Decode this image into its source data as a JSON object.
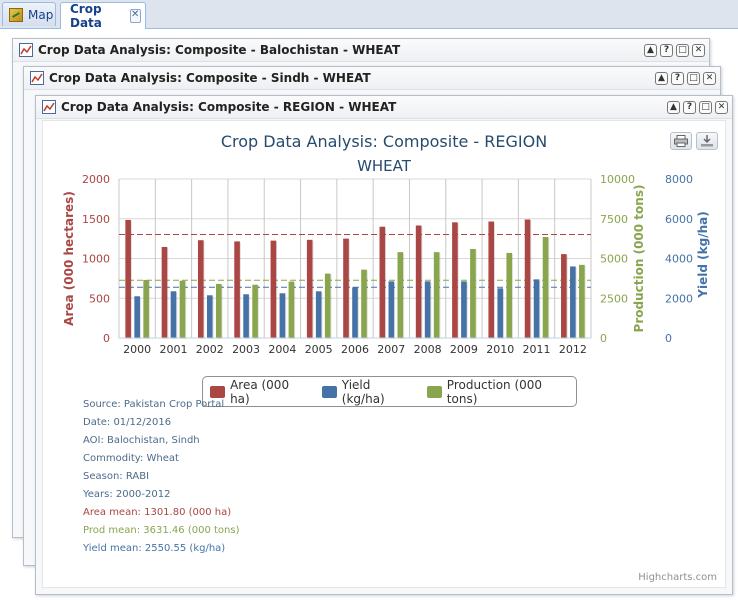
{
  "tabs": [
    {
      "label": "Map",
      "icon": "map-icon"
    },
    {
      "label": "Crop Data",
      "icon": "close-icon"
    }
  ],
  "windows": [
    {
      "title": "Crop Data Analysis: Composite - Balochistan - WHEAT"
    },
    {
      "title": "Crop Data Analysis: Composite - Sindh - WHEAT"
    },
    {
      "title": "Crop Data Analysis: Composite - REGION - WHEAT"
    }
  ],
  "window_tools": {
    "collapse": "▲",
    "help": "?",
    "maximize": "□",
    "close": "✕"
  },
  "chart_data": {
    "type": "bar",
    "title": "Crop Data Analysis: Composite - REGION",
    "subtitle": "WHEAT",
    "categories": [
      "2000",
      "2001",
      "2002",
      "2003",
      "2004",
      "2005",
      "2006",
      "2007",
      "2008",
      "2009",
      "2010",
      "2011",
      "2012"
    ],
    "series": [
      {
        "name": "Area (000 ha)",
        "color": "#aa4643",
        "axis": "left",
        "values": [
          1485,
          1145,
          1230,
          1215,
          1225,
          1235,
          1250,
          1400,
          1415,
          1455,
          1465,
          1490,
          1055
        ]
      },
      {
        "name": "Yield (kg/ha)",
        "color": "#4572a7",
        "axis": "right2",
        "values": [
          2100,
          2350,
          2150,
          2200,
          2250,
          2350,
          2550,
          2850,
          2850,
          2850,
          2500,
          2950,
          3600
        ]
      },
      {
        "name": "Production (000 tons)",
        "color": "#89a54e",
        "axis": "right1",
        "values": [
          3650,
          3600,
          3400,
          3350,
          3550,
          4050,
          4300,
          5400,
          5400,
          5600,
          5350,
          6350,
          4600
        ]
      }
    ],
    "axes": {
      "left": {
        "label": "Area (000 hectares)",
        "min": 0,
        "max": 2000,
        "ticks": [
          "0",
          "500",
          "1000",
          "1500",
          "2000"
        ],
        "color": "#aa4643"
      },
      "right1": {
        "label": "Production (000 tons)",
        "min": 0,
        "max": 10000,
        "ticks": [
          "0",
          "2500",
          "5000",
          "7500",
          "10000"
        ],
        "color": "#89a54e"
      },
      "right2": {
        "label": "Yield (kg/ha)",
        "min": 0,
        "max": 8000,
        "ticks": [
          "0",
          "2000",
          "4000",
          "6000",
          "8000"
        ],
        "color": "#4572a7"
      }
    },
    "means": {
      "area": 1301.8,
      "production": 3631.46,
      "yield": 2550.55
    },
    "legend_position": "bottom-center",
    "grid": true
  },
  "info_lines": [
    {
      "text": "Source: Pakistan Crop Portal",
      "color": "#4d6b8a"
    },
    {
      "text": "Date: 01/12/2016",
      "color": "#4d6b8a"
    },
    {
      "text": "AOI: Balochistan, Sindh",
      "color": "#4d6b8a"
    },
    {
      "text": "Commodity: Wheat",
      "color": "#4d6b8a"
    },
    {
      "text": "Season: RABI",
      "color": "#4d6b8a"
    },
    {
      "text": "Years: 2000-2012",
      "color": "#4d6b8a"
    },
    {
      "text": "Area mean: 1301.80 (000 ha)",
      "color": "#aa4643"
    },
    {
      "text": "Prod mean: 3631.46 (000 tons)",
      "color": "#89a54e"
    },
    {
      "text": "Yield mean: 2550.55 (kg/ha)",
      "color": "#4572a7"
    }
  ],
  "credits": "Highcharts.com"
}
